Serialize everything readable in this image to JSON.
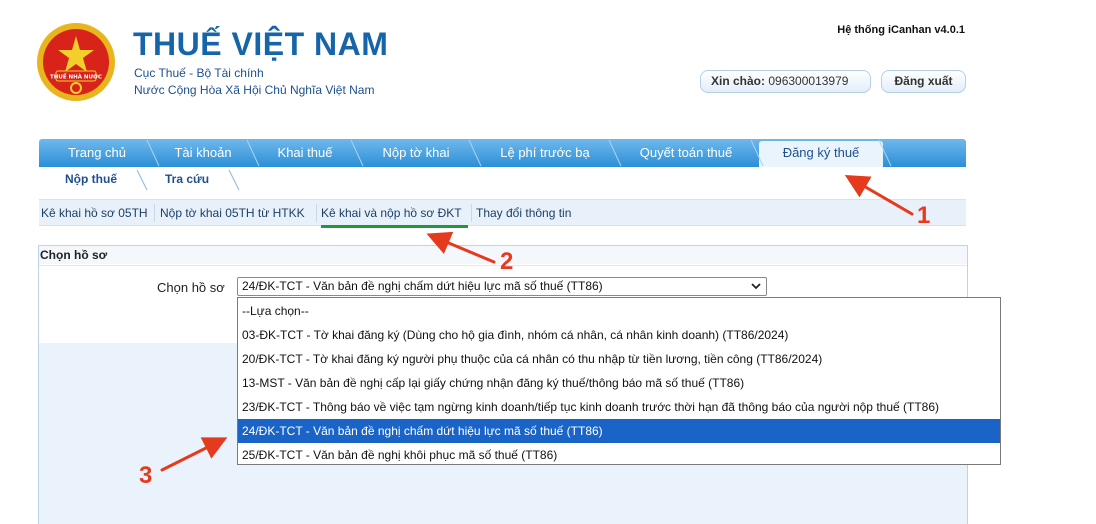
{
  "header": {
    "site_title": "THUẾ VIỆT NAM",
    "subtitle_1": "Cục Thuế - Bộ Tài chính",
    "subtitle_2": "Nước Cộng Hòa Xã Hội Chủ Nghĩa Việt Nam",
    "system_version": "Hệ thống iCanhan v4.0.1",
    "greeting_label": "Xin chào:",
    "greeting_user": "096300013979",
    "logout_label": "Đăng xuất",
    "emblem_text": "THUẾ NHÀ NƯỚC",
    "emblem_icon": "national-emblem"
  },
  "main_nav": {
    "tabs": [
      {
        "label": "Trang chủ"
      },
      {
        "label": "Tài khoản"
      },
      {
        "label": "Khai thuế"
      },
      {
        "label": "Nộp tờ khai"
      },
      {
        "label": "Lệ phí trước bạ"
      },
      {
        "label": "Quyết toán thuế"
      },
      {
        "label": "Đăng ký thuế",
        "active": true
      }
    ]
  },
  "sub_nav": {
    "tabs": [
      {
        "label": "Nộp thuế"
      },
      {
        "label": "Tra cứu"
      }
    ]
  },
  "third_nav": {
    "tabs": [
      {
        "label": "Kê khai hồ sơ 05TH"
      },
      {
        "label": "Nộp tờ khai 05TH từ HTKK"
      },
      {
        "label": "Kê khai và nộp hồ sơ ĐKT",
        "active": true
      },
      {
        "label": "Thay đổi thông tin"
      }
    ]
  },
  "panel": {
    "title": "Chọn hồ sơ",
    "field_label": "Chọn hồ sơ",
    "selected_value": "24/ĐK-TCT - Văn bản đề nghị chấm dứt hiệu lực mã số thuế (TT86)"
  },
  "dropdown": {
    "options": [
      {
        "label": "--Lựa chọn--"
      },
      {
        "label": "03-ĐK-TCT - Tờ khai đăng ký (Dùng cho hộ gia đình, nhóm cá nhân, cá nhân kinh doanh) (TT86/2024)"
      },
      {
        "label": "20/ĐK-TCT - Tờ khai đăng ký người phụ thuộc của cá nhân có thu nhập từ tiền lương, tiền công (TT86/2024)"
      },
      {
        "label": "13-MST - Văn bản đề nghị cấp lại giấy chứng nhận đăng ký thuế/thông báo mã số thuế (TT86)"
      },
      {
        "label": "23/ĐK-TCT - Thông báo về việc tạm ngừng kinh doanh/tiếp tục kinh doanh trước thời hạn đã thông báo của người nộp thuế (TT86)"
      },
      {
        "label": "24/ĐK-TCT - Văn bản đề nghị chấm dứt hiệu lực mã số thuế (TT86)",
        "selected": true
      },
      {
        "label": "25/ĐK-TCT - Văn bản đề nghị khôi phục mã số thuế (TT86)"
      }
    ]
  },
  "annotations": {
    "step_1": "1",
    "step_2": "2",
    "step_3": "3",
    "color": "#e53a1e"
  },
  "colors": {
    "brand_blue": "#1665a8",
    "nav_blue": "#2c8fd6",
    "selection_blue": "#1a64c8",
    "underline_green": "#1e9a3a"
  }
}
